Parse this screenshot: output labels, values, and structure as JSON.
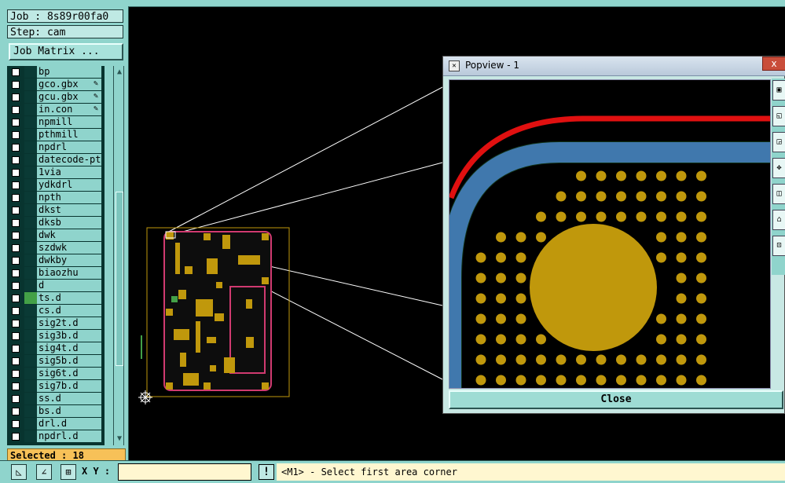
{
  "panel": {
    "job": "Job : 8s89r00fa0",
    "step": "Step: cam",
    "job_matrix_button": "Job Matrix ...",
    "selected": "Selected : 18"
  },
  "layers": [
    {
      "name": "bp",
      "edit": false,
      "color": ""
    },
    {
      "name": "gco.gbx",
      "edit": true,
      "color": ""
    },
    {
      "name": "gcu.gbx",
      "edit": true,
      "color": ""
    },
    {
      "name": "in.con",
      "edit": true,
      "color": ""
    },
    {
      "name": "npmill",
      "edit": false,
      "color": ""
    },
    {
      "name": "pthmill",
      "edit": false,
      "color": ""
    },
    {
      "name": "npdrl",
      "edit": false,
      "color": ""
    },
    {
      "name": "datecode-pt",
      "edit": false,
      "color": ""
    },
    {
      "name": "1via",
      "edit": false,
      "color": ""
    },
    {
      "name": "ydkdrl",
      "edit": false,
      "color": ""
    },
    {
      "name": "npth",
      "edit": false,
      "color": ""
    },
    {
      "name": "dkst",
      "edit": false,
      "color": ""
    },
    {
      "name": "dksb",
      "edit": false,
      "color": ""
    },
    {
      "name": "dwk",
      "edit": false,
      "color": ""
    },
    {
      "name": "szdwk",
      "edit": false,
      "color": ""
    },
    {
      "name": "dwkby",
      "edit": false,
      "color": ""
    },
    {
      "name": "biaozhu",
      "edit": false,
      "color": ""
    },
    {
      "name": "d",
      "edit": false,
      "color": ""
    },
    {
      "name": "ts.d",
      "edit": false,
      "color": "#43a047"
    },
    {
      "name": "cs.d",
      "edit": false,
      "color": ""
    },
    {
      "name": "sig2t.d",
      "edit": false,
      "color": ""
    },
    {
      "name": "sig3b.d",
      "edit": false,
      "color": ""
    },
    {
      "name": "sig4t.d",
      "edit": false,
      "color": ""
    },
    {
      "name": "sig5b.d",
      "edit": false,
      "color": ""
    },
    {
      "name": "sig6t.d",
      "edit": false,
      "color": ""
    },
    {
      "name": "sig7b.d",
      "edit": false,
      "color": ""
    },
    {
      "name": "ss.d",
      "edit": false,
      "color": ""
    },
    {
      "name": "bs.d",
      "edit": false,
      "color": ""
    },
    {
      "name": "drl.d",
      "edit": false,
      "color": ""
    },
    {
      "name": "npdrl.d",
      "edit": false,
      "color": ""
    }
  ],
  "bottom": {
    "xy_label": "X Y :",
    "xy_value": "",
    "message": "<M1> - Select first area corner"
  },
  "popview": {
    "title": "Popview - 1",
    "close_label": "Close",
    "close_x": "x"
  },
  "colors": {
    "panel_bg": "#8fd4cc",
    "board_copper": "#c0980c",
    "trace_blue": "#4a6ee8",
    "trace_red": "#e01010",
    "board_outline": "#d03a70",
    "selected_bg": "#f7c158"
  }
}
